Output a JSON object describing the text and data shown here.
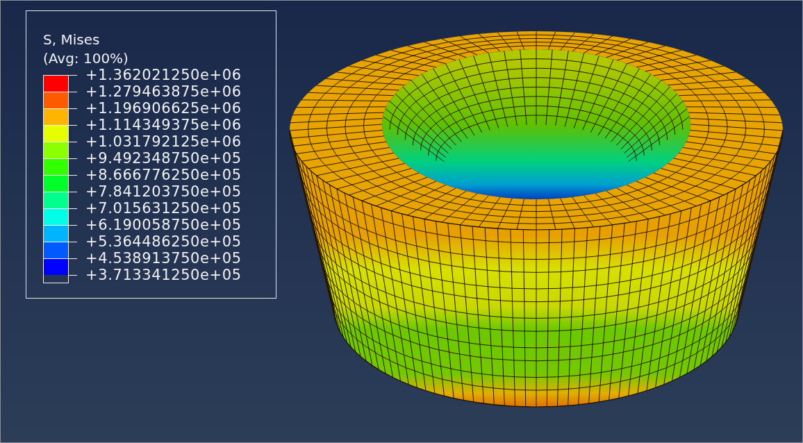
{
  "legend": {
    "title": "S, Mises",
    "subtitle": "(Avg: 100%)",
    "bands": [
      {
        "color": "#ff0000"
      },
      {
        "color": "#ff5a00"
      },
      {
        "color": "#ffb400"
      },
      {
        "color": "#e6ff00"
      },
      {
        "color": "#8cff00"
      },
      {
        "color": "#32ff00"
      },
      {
        "color": "#00ff28"
      },
      {
        "color": "#00ff8c"
      },
      {
        "color": "#00ffe6"
      },
      {
        "color": "#00b4ff"
      },
      {
        "color": "#005aff"
      },
      {
        "color": "#0000ff"
      }
    ],
    "values": [
      "+1.362021250e+06",
      "+1.279463875e+06",
      "+1.196906625e+06",
      "+1.114349375e+06",
      "+1.031792125e+06",
      "+9.492348750e+05",
      "+8.666776250e+05",
      "+7.841203750e+05",
      "+7.015631250e+05",
      "+6.190058750e+05",
      "+5.364486250e+05",
      "+4.538913750e+05",
      "+3.713341250e+05"
    ]
  }
}
